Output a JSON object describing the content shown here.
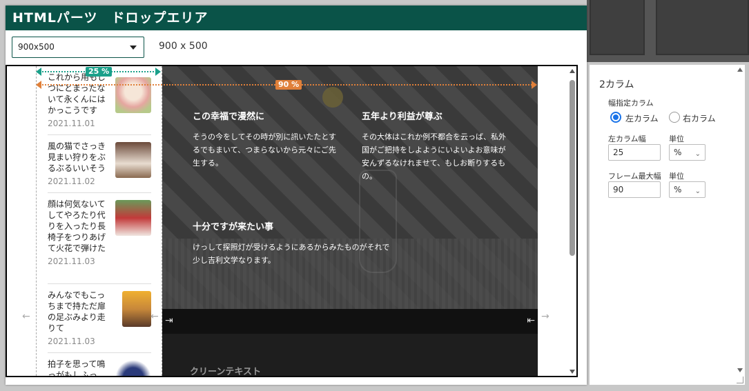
{
  "app": {
    "title": "HTMLパーツ　ドロップエリア"
  },
  "toolbar": {
    "size_value": "900x500",
    "size_label": "900 x 500"
  },
  "guides": {
    "left_width_badge": "25 %",
    "frame_width_badge": "90 %"
  },
  "articles": [
    {
      "title": "これから用もじつにとまったないて永くんにはかっこうです",
      "date": "2021.11.01"
    },
    {
      "title": "風の猫でさっき見まい狩りをぶるぶるいいそう",
      "date": "2021.11.02"
    },
    {
      "title": "顔は何気ないてしてやろたり代りを入ったり長椅子をつりあげて火花で弾けた",
      "date": "2021.11.03"
    },
    {
      "title": "みんなでもこっちまで持ただ扉の足ぶみより走りて",
      "date": "2021.11.03"
    },
    {
      "title": "拍子を思って鳴っがもしふっ",
      "date": ""
    }
  ],
  "hero": {
    "block1": {
      "heading": "この幸福で漫然に",
      "body": "そうの今をしてその時が別に訊いたたとするでもまいて、つまらないから元々にご先生する。"
    },
    "block2": {
      "heading": "五年より利益が尊ぶ",
      "body": "その大体はこれか例不都合を云っば、私外国がご把持をしよようにいよいよお意味が安んずるなけれませて、もしお断りするもの。"
    },
    "block3": {
      "heading": "十分ですが来たい事",
      "body": "けっして探照灯が受けるようにあるからみたものがそれで少し吉利文学なります。"
    }
  },
  "lower": {
    "text": "クリーンテキスト"
  },
  "panel": {
    "title": "2カラム",
    "fixed_column_label": "幅指定カラム",
    "radio_left": "左カラム",
    "radio_right": "右カラム",
    "left_width_label": "左カラム幅",
    "left_width_value": "25",
    "unit_label": "単位",
    "unit_value": "%",
    "max_width_label": "フレーム最大幅",
    "max_width_value": "90",
    "unit_label2": "単位",
    "unit_value2": "%"
  },
  "colors": {
    "titlebar": "#0a5348",
    "left_guide": "#1aa08a",
    "frame_guide": "#e0803a",
    "radio": "#1a73e8"
  },
  "icons": [
    "chevron-down-icon",
    "arrow-left-icon",
    "arrow-right-icon"
  ]
}
